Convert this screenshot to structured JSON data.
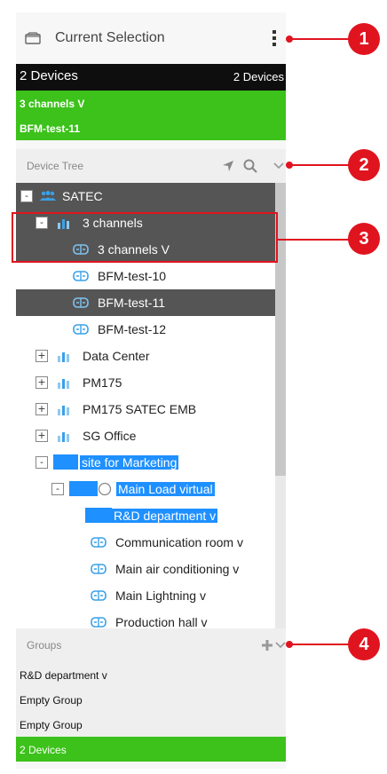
{
  "header": {
    "title": "Current Selection",
    "icon": "folder-icon"
  },
  "selection": {
    "left": "2 Devices",
    "right": "2 Devices",
    "items": [
      "3 channels V",
      "BFM-test-11"
    ]
  },
  "device_tree": {
    "title": "Device Tree",
    "rows": [
      {
        "label": "SATEC",
        "expander": "-",
        "icon": "people-icon"
      },
      {
        "label": "3 channels",
        "expander": "-",
        "icon": "bar-chart-icon"
      },
      {
        "label": "3 channels V",
        "icon": "device-icon"
      },
      {
        "label": "BFM-test-10",
        "icon": "device-icon"
      },
      {
        "label": "BFM-test-11",
        "icon": "device-icon"
      },
      {
        "label": "BFM-test-12",
        "icon": "device-icon"
      },
      {
        "label": "Data Center",
        "expander": "+",
        "icon": "bar-chart-icon"
      },
      {
        "label": "PM175",
        "expander": "+",
        "icon": "bar-chart-icon"
      },
      {
        "label": "PM175 SATEC EMB",
        "expander": "+",
        "icon": "bar-chart-icon"
      },
      {
        "label": "SG Office",
        "expander": "+",
        "icon": "bar-chart-icon"
      },
      {
        "label": "site for Marketing",
        "expander": "-",
        "icon": "bar-chart-icon"
      },
      {
        "label": "Main Load virtual",
        "expander": "-",
        "icon": "device-icon"
      },
      {
        "label": "R&D department v",
        "icon": "device-icon"
      },
      {
        "label": "Communication room v",
        "icon": "device-icon"
      },
      {
        "label": "Main air conditioning v",
        "icon": "device-icon"
      },
      {
        "label": "Main Lightning v",
        "icon": "device-icon"
      },
      {
        "label": "Production hall v",
        "icon": "device-icon"
      }
    ]
  },
  "groups": {
    "title": "Groups",
    "items": [
      "R&D department v",
      "Empty Group",
      "Empty Group",
      "2 Devices"
    ]
  },
  "annotations": [
    "1",
    "2",
    "3",
    "4"
  ],
  "colors": {
    "accent_green": "#3cc21a",
    "annotation_red": "#e0141f",
    "dark_row": "#555555",
    "highlight_blue": "#1e90ff"
  }
}
